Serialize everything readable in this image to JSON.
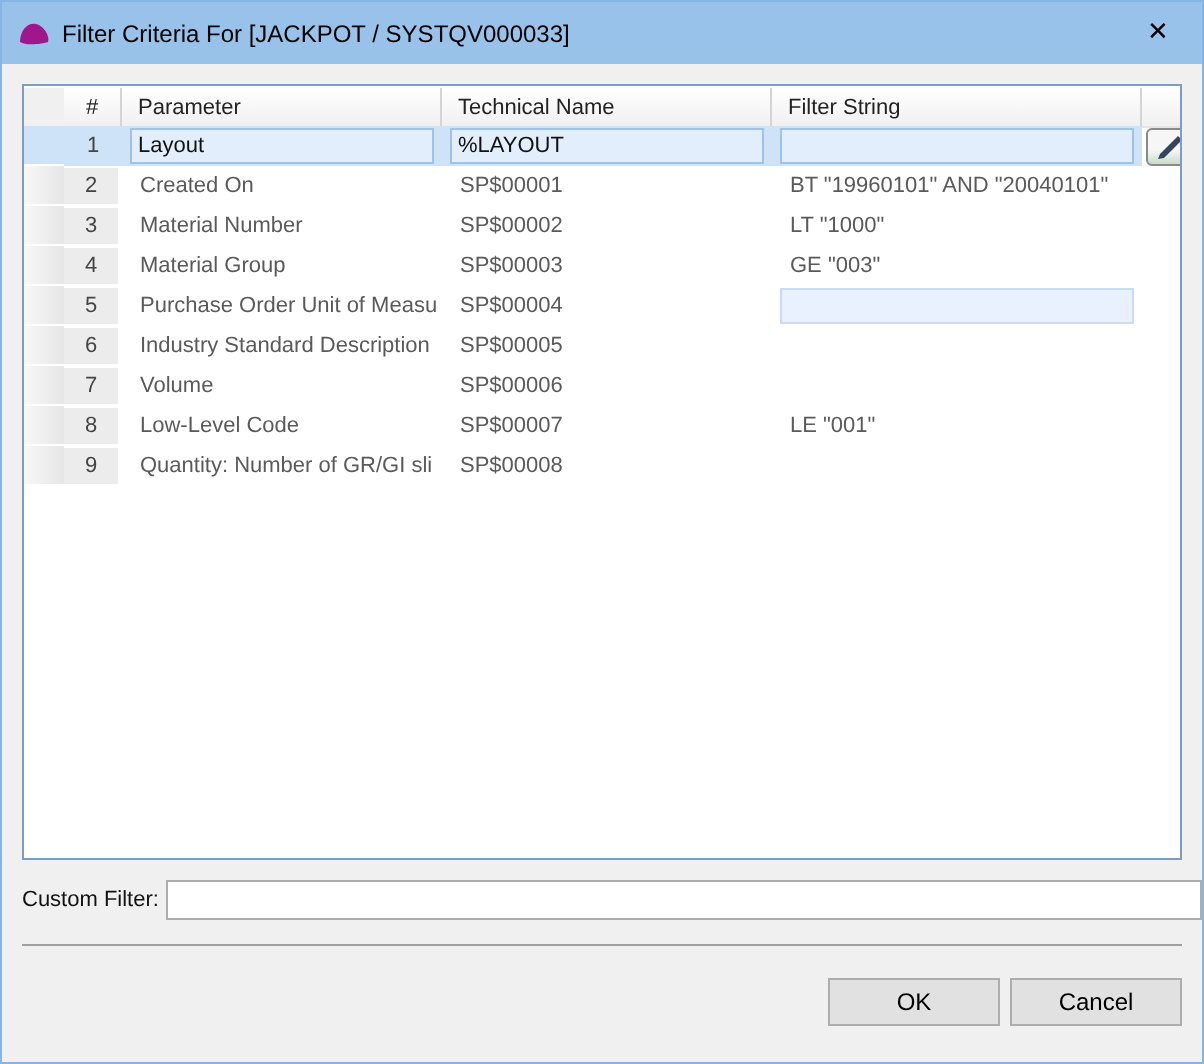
{
  "window": {
    "title": "Filter Criteria For [JACKPOT / SYSTQV000033]",
    "close": "✕"
  },
  "table": {
    "columns": [
      "#",
      "Parameter",
      "Technical Name",
      "Filter String"
    ],
    "rows": [
      {
        "number": "1",
        "parameter": "Layout",
        "technical_name": "%LAYOUT",
        "filter": "",
        "selected": true,
        "filter_active": true
      },
      {
        "number": "2",
        "parameter": "Created On",
        "technical_name": "SP$00001",
        "filter": "BT \"19960101\" AND \"20040101\"",
        "selected": false,
        "filter_active": false
      },
      {
        "number": "3",
        "parameter": "Material Number",
        "technical_name": "SP$00002",
        "filter": "LT \"1000\"",
        "selected": false,
        "filter_active": false
      },
      {
        "number": "4",
        "parameter": "Material Group",
        "technical_name": "SP$00003",
        "filter": "GE \"003\"",
        "selected": false,
        "filter_active": false
      },
      {
        "number": "5",
        "parameter": "Purchase Order Unit of Measu",
        "technical_name": "SP$00004",
        "filter": "",
        "selected": false,
        "filter_active": true
      },
      {
        "number": "6",
        "parameter": "Industry Standard Description",
        "technical_name": "SP$00005",
        "filter": "",
        "selected": false,
        "filter_active": false
      },
      {
        "number": "7",
        "parameter": "Volume",
        "technical_name": "SP$00006",
        "filter": "",
        "selected": false,
        "filter_active": false
      },
      {
        "number": "8",
        "parameter": "Low-Level Code",
        "technical_name": "SP$00007",
        "filter": "LE \"001\"",
        "selected": false,
        "filter_active": false
      },
      {
        "number": "9",
        "parameter": "Quantity: Number of GR/GI sli",
        "technical_name": "SP$00008",
        "filter": "",
        "selected": false,
        "filter_active": false
      }
    ]
  },
  "custom_filter": {
    "label": "Custom Filter:"
  },
  "buttons": [
    "OK",
    "Cancel"
  ]
}
